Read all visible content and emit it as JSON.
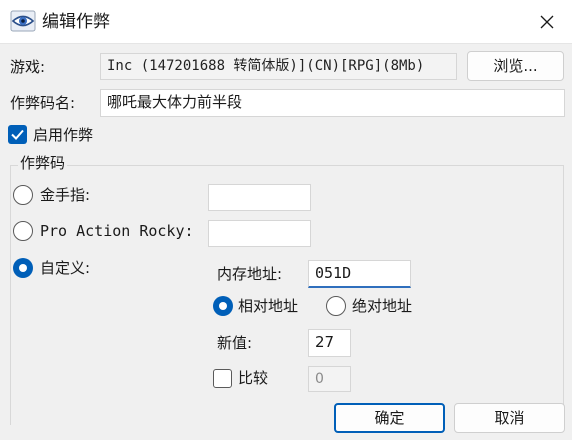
{
  "window": {
    "title": "编辑作弊",
    "icon": "eye-icon",
    "close_icon": "close-icon"
  },
  "game": {
    "label": "游戏:",
    "value": "Inc (147201688 转简体版)](CN)[RPG](8Mb)",
    "browse_label": "浏览..."
  },
  "cheat_name": {
    "label": "作弊码名:",
    "value": "哪吒最大体力前半段"
  },
  "enable": {
    "label": "启用作弊",
    "checked": true
  },
  "group": {
    "label": "作弊码",
    "gold_finger_label": "金手指:",
    "gold_finger_value": "",
    "par_label": "Pro Action Rocky:",
    "par_value": "",
    "custom_label": "自定义:",
    "selected": "custom"
  },
  "custom": {
    "address_label": "内存地址:",
    "address_value": "051D",
    "relative_label": "相对地址",
    "absolute_label": "绝对地址",
    "address_mode": "relative",
    "new_value_label": "新值:",
    "new_value": "27",
    "compare_label": "比较",
    "compare_checked": false,
    "compare_value": "0"
  },
  "buttons": {
    "ok_label": "确定",
    "cancel_label": "取消"
  },
  "colors": {
    "accent": "#005fb8",
    "dialog_bg": "#f0f0f0"
  }
}
